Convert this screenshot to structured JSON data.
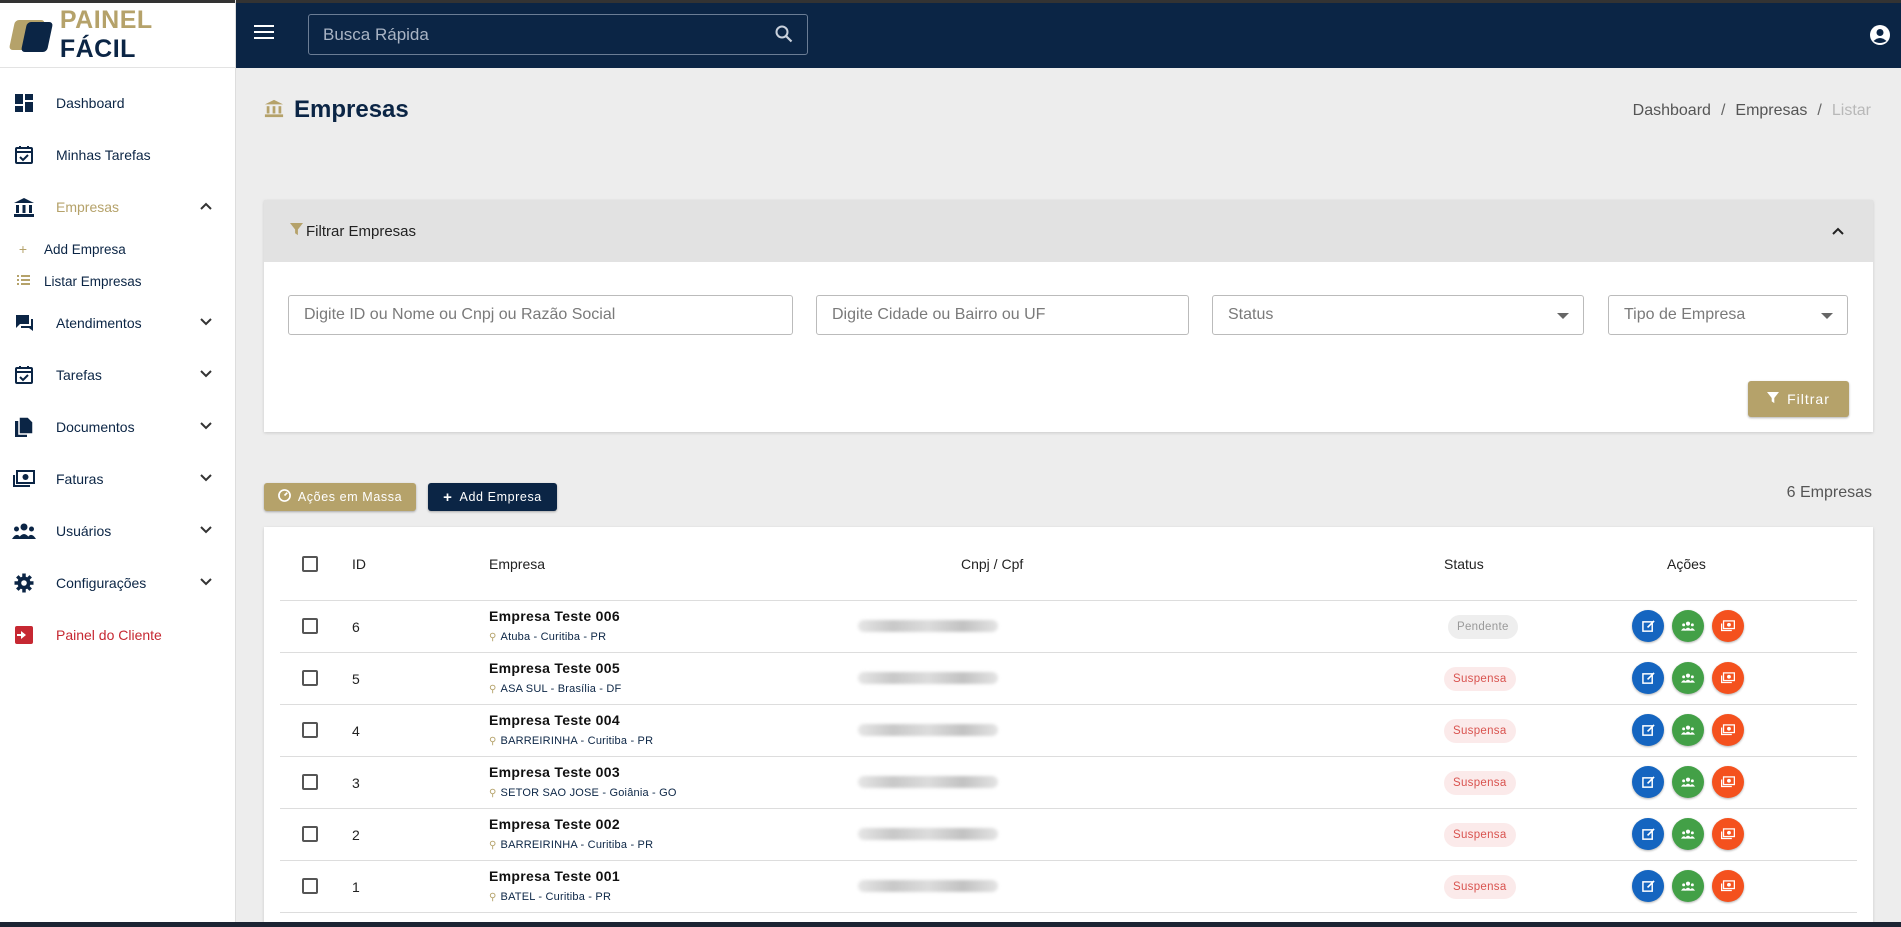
{
  "brand": {
    "part1": "PAINEL",
    "part2": "FÁCIL"
  },
  "sidebar": {
    "items": [
      {
        "label": "Dashboard",
        "icon": "dashboard-icon"
      },
      {
        "label": "Minhas Tarefas",
        "icon": "calendar-check-icon"
      },
      {
        "label": "Empresas",
        "icon": "bank-icon",
        "active": true
      },
      {
        "label": "Atendimentos",
        "icon": "chat-icon"
      },
      {
        "label": "Tarefas",
        "icon": "calendar-check-icon"
      },
      {
        "label": "Documentos",
        "icon": "documents-icon"
      },
      {
        "label": "Faturas",
        "icon": "money-icon"
      },
      {
        "label": "Usuários",
        "icon": "users-icon"
      },
      {
        "label": "Configurações",
        "icon": "gear-icon"
      },
      {
        "label": "Painel do Cliente",
        "icon": "login-icon"
      }
    ],
    "subitems": [
      {
        "label": "Add Empresa",
        "icon": "plus-icon"
      },
      {
        "label": "Listar Empresas",
        "icon": "list-icon"
      }
    ]
  },
  "topbar": {
    "search_placeholder": "Busca Rápida"
  },
  "page": {
    "title": "Empresas",
    "breadcrumb": [
      "Dashboard",
      "Empresas",
      "Listar"
    ]
  },
  "filter": {
    "title": "Filtrar Empresas",
    "fields": {
      "id_placeholder": "Digite ID ou Nome ou Cnpj ou Razão Social",
      "city_placeholder": "Digite Cidade ou Bairro ou UF",
      "status_placeholder": "Status",
      "type_placeholder": "Tipo de Empresa"
    },
    "button": "Filtrar"
  },
  "actions": {
    "mass": "Ações em Massa",
    "add": "Add Empresa",
    "count": "6 Empresas"
  },
  "table": {
    "headers": {
      "id": "ID",
      "empresa": "Empresa",
      "cnpj": "Cnpj / Cpf",
      "status": "Status",
      "acoes": "Ações"
    },
    "rows": [
      {
        "id": "6",
        "name": "Empresa Teste 006",
        "location": "Atuba - Curitiba - PR",
        "status": "Pendente"
      },
      {
        "id": "5",
        "name": "Empresa Teste 005",
        "location": "ASA SUL - Brasília - DF",
        "status": "Suspensa"
      },
      {
        "id": "4",
        "name": "Empresa Teste 004",
        "location": "BARREIRINHA - Curitiba - PR",
        "status": "Suspensa"
      },
      {
        "id": "3",
        "name": "Empresa Teste 003",
        "location": "SETOR SAO JOSE - Goiânia - GO",
        "status": "Suspensa"
      },
      {
        "id": "2",
        "name": "Empresa Teste 002",
        "location": "BARREIRINHA - Curitiba - PR",
        "status": "Suspensa"
      },
      {
        "id": "1",
        "name": "Empresa Teste 001",
        "location": "BATEL - Curitiba - PR",
        "status": "Suspensa"
      }
    ]
  },
  "colors": {
    "navy": "#0b2545",
    "gold": "#b5a26a",
    "red": "#c62832"
  }
}
